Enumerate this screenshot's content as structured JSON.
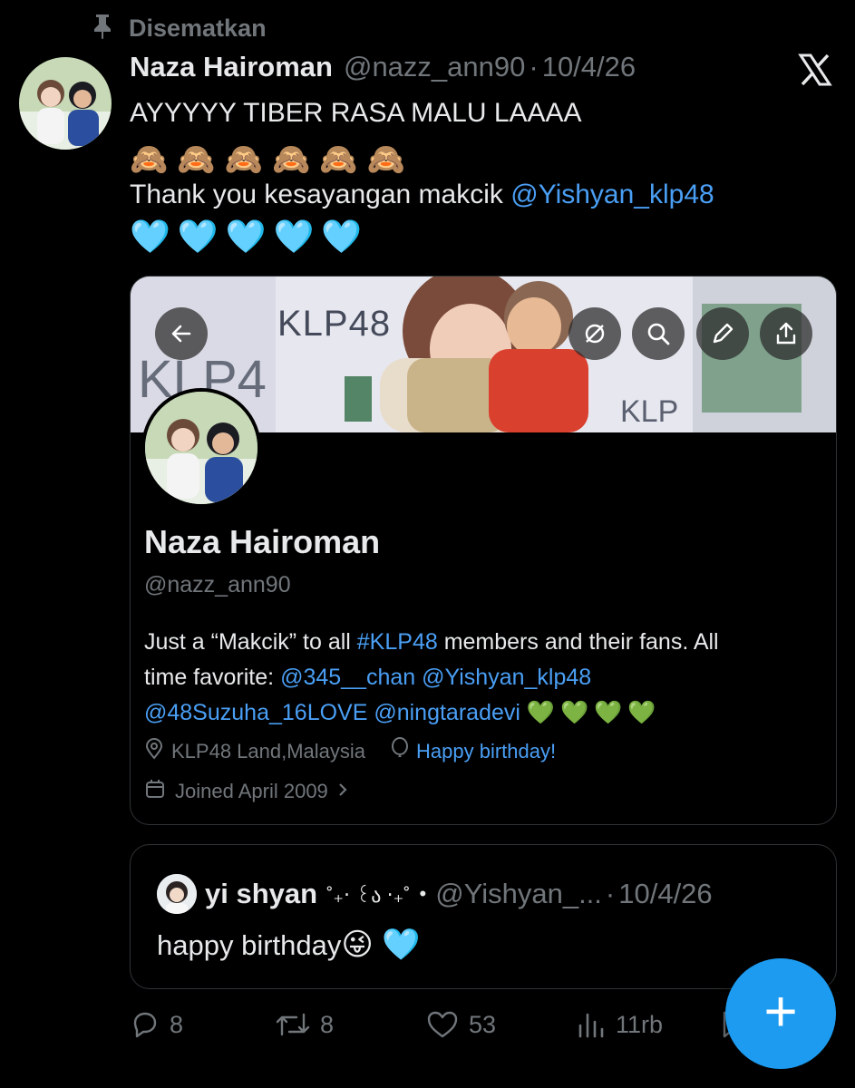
{
  "pinned": {
    "label": "Disematkan"
  },
  "post": {
    "author_name": "Naza Hairoman",
    "handle": "@nazz_ann90",
    "separator": "·",
    "date": "10/4/26",
    "line1": "AYYYYY TIBER RASA MALU LAAAA",
    "emoji_monkeys": "🙈🙈🙈🙈🙈🙈",
    "line3_text": "Thank you kesayangan makcik ",
    "line3_mention": "@Yishyan_klp48",
    "emoji_hearts": "🩵🩵🩵🩵🩵"
  },
  "profile_card": {
    "banner_text_1": "KLP48",
    "banner_text_2": "KLP4",
    "banner_text_3": "KLP",
    "name": "Naza Hairoman",
    "handle": "@nazz_ann90",
    "bio_1": "Just a “Makcik” to all ",
    "bio_hashtag": "#KLP48",
    "bio_2": " members and their fans. All",
    "bio_3": "time favorite: ",
    "bio_mention_1": "@345__chan",
    "bio_mention_2": "@Yishyan_klp48",
    "bio_mention_3": "@48Suzuha_16LOVE",
    "bio_mention_4": "@ningtaradevi",
    "bio_hearts": "💚💚💚💚",
    "location": "KLP48 Land,Malaysia",
    "birthday": "Happy birthday!",
    "joined": "Joined April 2009",
    "icons": [
      "back-arrow-icon",
      "hide-icon",
      "search-icon",
      "edit-pencil-icon",
      "share-icon",
      "location-pin-icon",
      "balloon-icon",
      "calendar-icon",
      "chevron-right-icon"
    ]
  },
  "quote": {
    "name": "yi shyan",
    "name_decor": "˚₊‧ ꒰ა ‧₊˚",
    "bullet": "•",
    "handle": "@Yishyan_...",
    "separator": "·",
    "date": "10/4/26",
    "text": "happy birthday",
    "emoji": "😜 🩵"
  },
  "actions": {
    "replies": "8",
    "reposts": "8",
    "likes": "53",
    "views": "11rb",
    "icons": [
      "reply-icon",
      "repost-icon",
      "like-icon",
      "views-icon",
      "bookmark-icon"
    ]
  },
  "fab": {
    "label": "+"
  },
  "colors": {
    "background": "#000000",
    "text": "#e7e9ea",
    "muted": "#71767b",
    "link": "#4a9ff5",
    "accent": "#1d9bf0",
    "border": "#2f3336"
  }
}
